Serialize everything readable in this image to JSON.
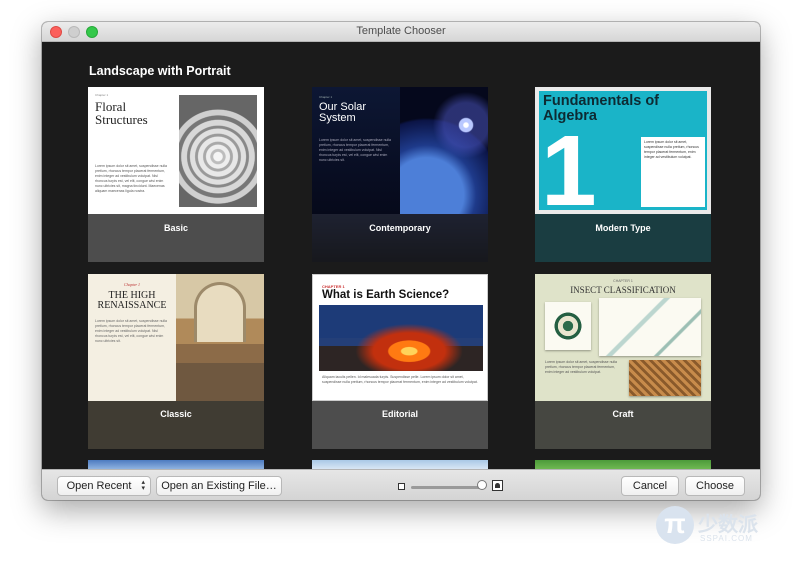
{
  "window": {
    "title": "Template Chooser"
  },
  "section": {
    "title": "Landscape with Portrait"
  },
  "templates": [
    {
      "name": "Basic",
      "chapter": "Chapter 1",
      "title": "Floral Structures",
      "body": "Lorem ipsum dolor sit amet, suspendisse nulla pretium, rhoncus tempor placerat fermentum, enim integer ad vestibulum volutpat. Nisl rhoncus turpis est, vel elit, congue wisi enim nunc ultricies sit, magna tincidunt. Maecenas aliquam maecenas ligula nostra."
    },
    {
      "name": "Contemporary",
      "chapter": "Chapter 1",
      "title": "Our Solar System",
      "body": "Lorem ipsum dolor sit amet, suspendisse nulla pretium, rhoncus tempor placerat fermentum, enim integer ad vestibulum volutpat. Nisl rhoncus turpis est, vel elit, congue wisi enim nunc ultricies sit."
    },
    {
      "name": "Modern Type",
      "title": "Fundamentals of Algebra",
      "big_number": "1",
      "body": "Lorem ipsum dolor sit amet, suspendisse nulla pretium, rhoncus tempor placerat fermentum, enim integer ad vestibulum volutpat."
    },
    {
      "name": "Classic",
      "chapter": "Chapter 1",
      "title": "THE HIGH RENAISSANCE",
      "body": "Lorem ipsum dolor sit amet, suspendisse nulla pretium, rhoncus tempor placerat fermentum, enim integer ad vestibulum volutpat. Nisl rhoncus turpis est, vel elit, congue wisi enim nunc ultricies sit."
    },
    {
      "name": "Editorial",
      "chapter": "CHAPTER 1",
      "title": "What is Earth Science?",
      "body": "Aliquam iaculis pellen. Id malesuada turpis. Suspendisse pelle. Lorem ipsum dolor sit amet, suspendisse nulla pretium, rhoncus tempor placerat fermentum, enim integer ad vestibulum volutpat."
    },
    {
      "name": "Craft",
      "chapter": "CHAPTER 1",
      "title": "INSECT CLASSIFICATION",
      "body": "Lorem ipsum dolor sit amet, suspendisse nulla pretium, rhoncus tempor placerat fermentum, enim integer ad vestibulum volutpat."
    }
  ],
  "toolbar": {
    "open_recent": "Open Recent",
    "open_existing": "Open an Existing File…",
    "cancel": "Cancel",
    "choose": "Choose"
  },
  "watermark": {
    "pi": "π",
    "cn": "少数派",
    "en": "SSPAI.COM"
  },
  "colors": {
    "content_bg": "#1b1b1b",
    "modern_accent": "#1ab4c8",
    "close": "#fc605c",
    "zoom": "#34c84a"
  },
  "icons": [
    "small-page-icon",
    "large-page-icon",
    "popup-arrows-icon"
  ]
}
